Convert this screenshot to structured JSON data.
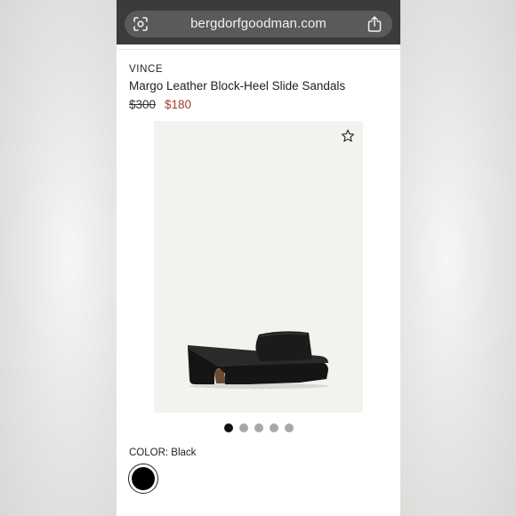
{
  "browser": {
    "url": "bergdorfgoodman.com",
    "lens_icon": "camera-search-icon",
    "share_icon": "share-icon"
  },
  "product": {
    "brand": "VINCE",
    "name": "Margo Leather Block-Heel Slide Sandals",
    "price_original": "$300",
    "price_sale": "$180",
    "favorite_icon": "star-outline-icon",
    "image_subject": "black leather block-heel slide sandal",
    "gallery": {
      "total": 5,
      "active_index": 1
    },
    "color_label": "COLOR: Black",
    "swatches": [
      {
        "color": "#000000",
        "selected": true
      }
    ]
  },
  "colors": {
    "browser_bar": "#3b3b3d",
    "sale_price": "#a23b35",
    "image_bg": "#f3f2ee"
  }
}
